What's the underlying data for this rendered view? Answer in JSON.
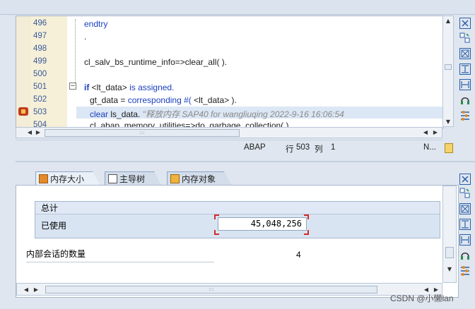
{
  "editor": {
    "lines": [
      {
        "num": "496",
        "code": "endtry",
        "style": "kw"
      },
      {
        "num": "497",
        "code": ".",
        "style": "plain"
      },
      {
        "num": "498",
        "code": "",
        "style": "plain"
      },
      {
        "num": "499",
        "code": "cl_salv_bs_runtime_info=>clear_all( ).",
        "style": "plain"
      },
      {
        "num": "500",
        "code": "",
        "style": "plain"
      },
      {
        "num": "501",
        "code": "",
        "style": "plain"
      },
      {
        "num": "502",
        "code": "",
        "style": "plain"
      },
      {
        "num": "503",
        "code": "",
        "style": "plain"
      },
      {
        "num": "504",
        "code": "cl_abap_memory_utilities=>do_garbage_collection( ).",
        "style": "plain"
      }
    ],
    "line501_kw1": "if",
    "line501_mid": " <lt_data> ",
    "line501_kw2": "is assigned.",
    "line502_pre": "gt_data = ",
    "line502_kw": "corresponding #(",
    "line502_post": " <lt_data> ).",
    "line503_kw": "clear",
    "line503_mid": " ls_data. ",
    "line503_comment": "\"释放内存 SAP40 for wangliuqing 2022-9-16 16:06:54"
  },
  "status": {
    "language": "ABAP",
    "row_label": "行",
    "row_value": "503",
    "col_label": "列",
    "col_value": "1",
    "mode": "N..."
  },
  "tabs": [
    {
      "label": "内存大小",
      "icon": "memory-size-icon",
      "active": true
    },
    {
      "label": "主导树",
      "icon": "tree-icon",
      "active": false
    },
    {
      "label": "内存对象",
      "icon": "memory-object-icon",
      "active": false
    }
  ],
  "totals": {
    "header": "总计",
    "used_label": "已使用",
    "used_value": "45,048,256"
  },
  "sessions": {
    "label": "内部会话的数量",
    "value": "4"
  },
  "watermark": "CSDN @小懒lan",
  "icons": {
    "scroll_left": "◀",
    "scroll_right": "▶",
    "scroll_up": "▲",
    "scroll_down": "▼",
    "thumb_grip": ":::"
  }
}
